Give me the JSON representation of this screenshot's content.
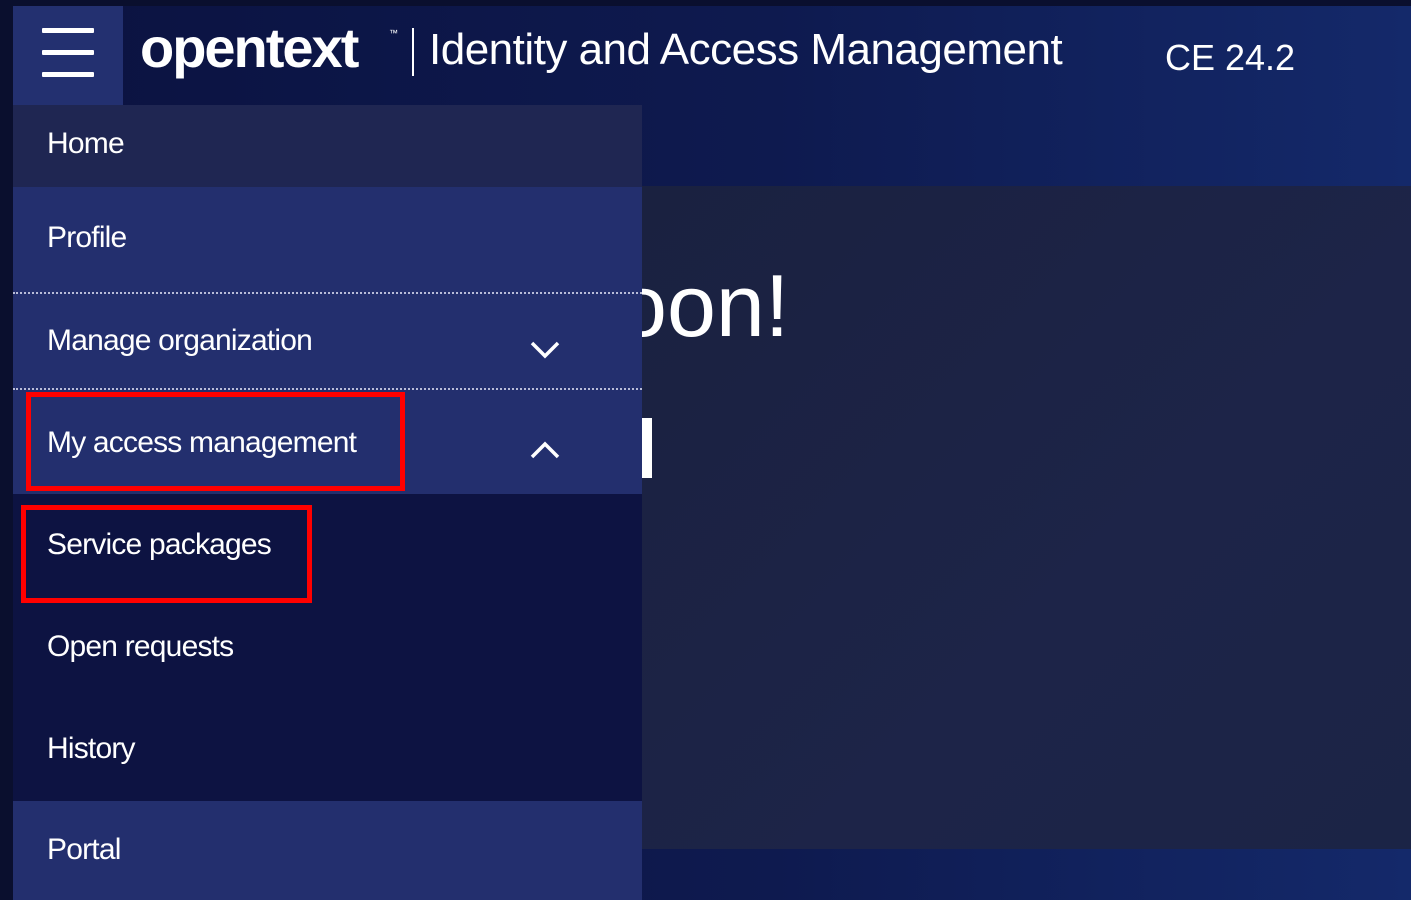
{
  "header": {
    "menu_icon": "hamburger-menu-icon",
    "logo_text": "opentext",
    "logo_tm": "™",
    "app_title": "Identity and Access Management",
    "version": "CE 24.2"
  },
  "main": {
    "greeting_fragment": "oon!"
  },
  "sidebar": {
    "items": [
      {
        "label": "Home"
      },
      {
        "label": "Profile"
      },
      {
        "label": "Manage organization",
        "icon": "chevron-down-icon"
      },
      {
        "label": "My access management",
        "icon": "chevron-up-icon",
        "expanded": true
      },
      {
        "label": "Service packages",
        "submenu": true
      },
      {
        "label": "Open requests",
        "submenu": true
      },
      {
        "label": "History",
        "submenu": true
      },
      {
        "label": "Portal"
      }
    ]
  },
  "colors": {
    "sidebar_item_bg": "#1f2652",
    "sidebar_item_alt_bg": "#232f6e",
    "submenu_bg": "#0d1342",
    "highlight": "#ff0000",
    "text": "#ffffff"
  }
}
